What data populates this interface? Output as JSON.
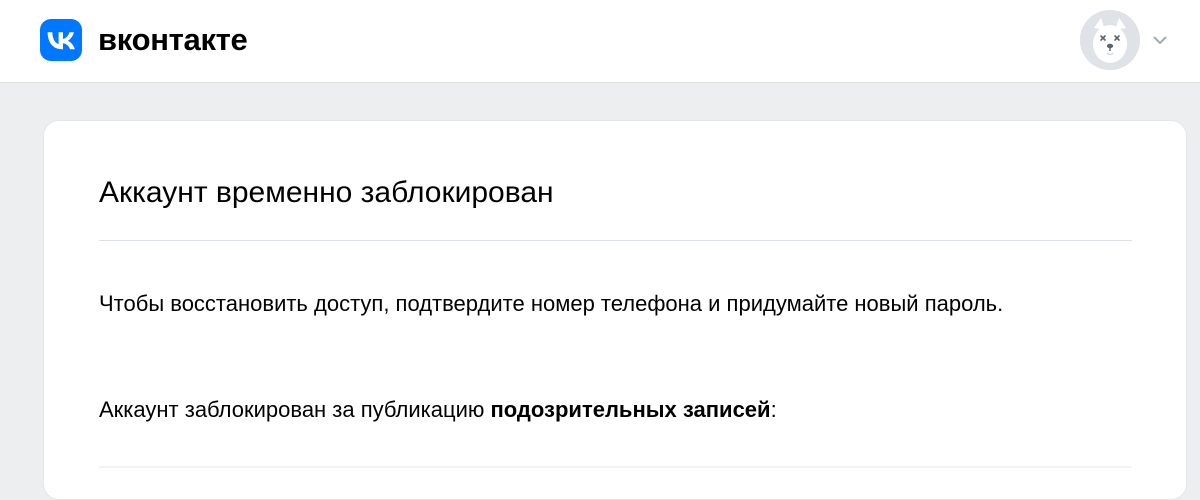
{
  "header": {
    "logo_text": "вконтакте",
    "brand_color": "#0077ff",
    "logo_icon": "vk-logo-icon",
    "avatar_icon": "deactivated-dog-avatar",
    "menu_icon": "chevron-down-icon"
  },
  "card": {
    "title": "Аккаунт временно заблокирован",
    "paragraph1": "Чтобы восстановить доступ, подтвердите номер телефона и придумайте новый пароль.",
    "paragraph2_prefix": "Аккаунт заблокирован за публикацию ",
    "paragraph2_bold": "подозрительных записей",
    "paragraph2_suffix": ":"
  }
}
